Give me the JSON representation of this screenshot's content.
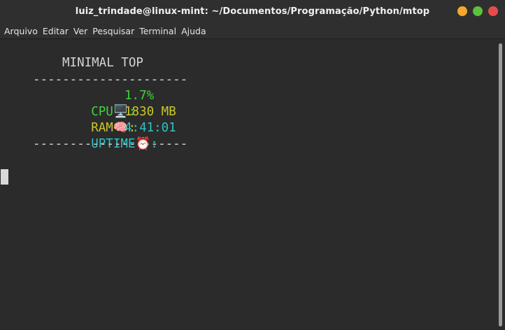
{
  "window": {
    "title": "luiz_trindade@linux-mint: ~/Documentos/Programação/Python/mtop",
    "buttons": {
      "minimize_color": "#f5a82c",
      "maximize_color": "#5fbf3a",
      "close_color": "#e94b4b"
    }
  },
  "menu": {
    "items": [
      "Arquivo",
      "Editar",
      "Ver",
      "Pesquisar",
      "Terminal",
      "Ajuda"
    ]
  },
  "terminal": {
    "header": "MINIMAL TOP",
    "separator": "---------------------",
    "cpu": {
      "label": "CPU",
      "icon": "🖥️",
      "value": "1.7%",
      "color": "#3ed33e"
    },
    "ram": {
      "label": "RAM",
      "icon": "🧠",
      "value": "1830 MB",
      "color": "#c8c82b"
    },
    "uptime": {
      "label": "UPTIME",
      "icon": "⏰",
      "value": "4:41:01",
      "color": "#2bc3c3"
    },
    "text_color": "#d3d3d3",
    "background": "#2b2b2b"
  }
}
